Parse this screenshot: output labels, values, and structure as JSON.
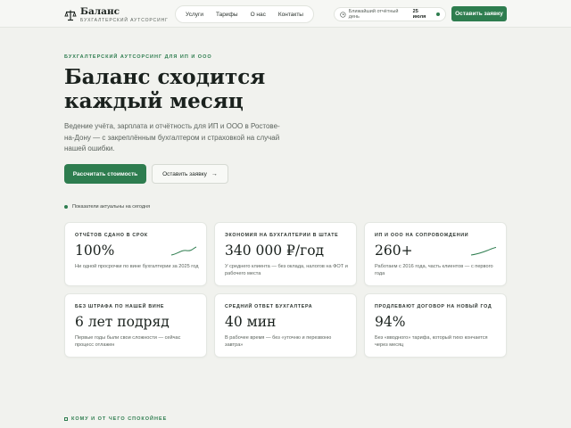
{
  "header": {
    "logo_title": "Баланс",
    "logo_subtitle": "БУХГАЛТЕРСКИЙ АУТСОРСИНГ",
    "logo_icon": "scales-icon",
    "nav": [
      "Услуги",
      "Тарифы",
      "О нас",
      "Контакты"
    ],
    "deadline_label": "Ближайший отчётный день",
    "deadline_date": "25 июля",
    "cta": "Оставить заявку"
  },
  "hero": {
    "eyebrow": "БУХГАЛТЕРСКИЙ АУТСОРСИНГ ДЛЯ ИП И ООО",
    "title": "Баланс сходится каждый месяц",
    "description": "Ведение учёта, зарплата и отчётность для ИП и ООО в Ростове-на-Дону — с закреплённым бухгалтером и страховкой на случай нашей ошибки.",
    "primary_button": "Рассчитать стоимость",
    "secondary_button": "Оставить заявку",
    "secondary_arrow": "→"
  },
  "status_note": "Показатели актуальны на сегодня",
  "accent_color": "#2e7d4f",
  "stats": [
    {
      "label": "ОТЧЁТОВ СДАНО В СРОК",
      "value": "100%",
      "note": "Ни одной просрочки по вине бухгалтерии за 2025 год",
      "sparkline": true
    },
    {
      "label": "ЭКОНОМИЯ НА БУХГАЛТЕРИИ В ШТАТЕ",
      "value": "340 000 ₽/год",
      "note": "У среднего клиента — без оклада, налогов на ФОТ и рабочего места",
      "sparkline": false
    },
    {
      "label": "ИП И ООО НА СОПРОВОЖДЕНИИ",
      "value": "260+",
      "note": "Работаем с 2016 года, часть клиентов — с первого года",
      "sparkline": true
    },
    {
      "label": "БЕЗ ШТРАФА ПО НАШЕЙ ВИНЕ",
      "value": "6 лет подряд",
      "note": "Первые годы были свои сложности — сейчас процесс отлажен",
      "sparkline": false
    },
    {
      "label": "СРЕДНИЙ ОТВЕТ БУХГАЛТЕРА",
      "value": "40 мин",
      "note": "В рабочее время — без «уточню и перезвоню завтра»",
      "sparkline": false
    },
    {
      "label": "ПРОДЛЕВАЮТ ДОГОВОР НА НОВЫЙ ГОД",
      "value": "94%",
      "note": "Без «вводного» тарифа, который тихо кончается через месяц",
      "sparkline": false
    }
  ],
  "next_section": "КОМУ И ОТ ЧЕГО СПОКОЙНЕЕ"
}
